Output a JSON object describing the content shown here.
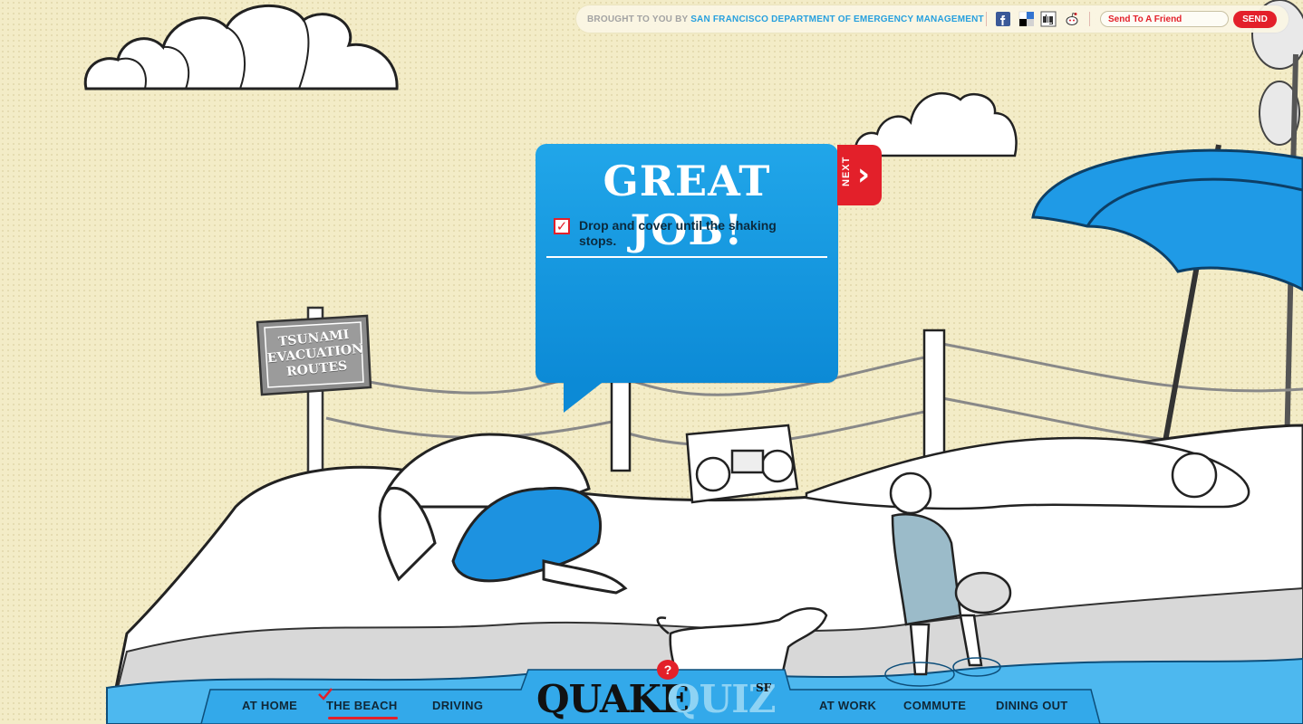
{
  "header": {
    "brought_prefix": "BROUGHT TO YOU BY",
    "brought_org": "SAN FRANCISCO DEPARTMENT OF EMERGENCY MANAGEMENT",
    "social_icons": [
      "facebook-icon",
      "delicious-icon",
      "digg-icon",
      "reddit-icon"
    ],
    "send_placeholder": "Send To A Friend",
    "send_label": "SEND"
  },
  "quiz": {
    "title": "GREAT JOB!",
    "answer_checked": true,
    "answer_text": "Drop and cover until the shaking stops.",
    "next_label": "NEXT"
  },
  "scene": {
    "sign_text": "TSUNAMI EVACUATION ROUTES"
  },
  "nav": {
    "left": [
      "AT HOME",
      "THE BEACH",
      "DRIVING"
    ],
    "right": [
      "AT WORK",
      "COMMUTE",
      "DINING OUT"
    ],
    "active": "THE BEACH",
    "logo_quake": "QUAKE",
    "logo_quiz": "QUIZ",
    "logo_sf": "SF",
    "help_badge": "?"
  },
  "colors": {
    "accent_red": "#e3202a",
    "accent_blue": "#1b9ee6",
    "background": "#f3ecc7"
  }
}
